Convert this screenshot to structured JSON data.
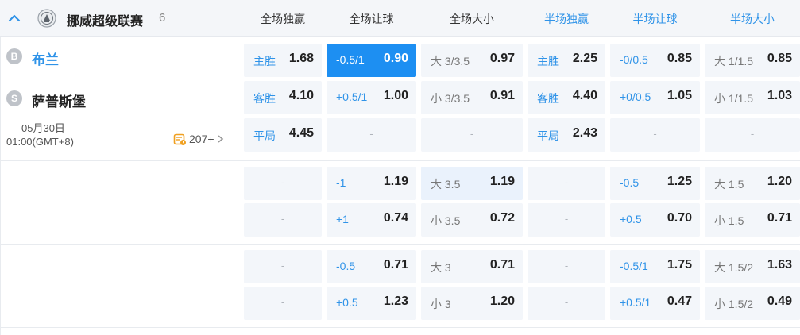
{
  "league": {
    "name": "挪威超级联赛",
    "count": "6",
    "columns": [
      "全场独赢",
      "全场让球",
      "全场大小",
      "半场独赢",
      "半场让球",
      "半场大小"
    ]
  },
  "match": {
    "home_badge": "B",
    "home": "布兰",
    "away_badge": "S",
    "away": "萨普斯堡",
    "date": "05月30日",
    "time": "01:00(GMT+8)",
    "more": "207+"
  },
  "odds": {
    "c1": [
      [
        "主胜",
        "1.68"
      ],
      [
        "客胜",
        "4.10"
      ],
      [
        "平局",
        "4.45"
      ],
      [
        "-",
        ""
      ],
      [
        "-",
        ""
      ],
      [
        "-",
        ""
      ],
      [
        "-",
        ""
      ]
    ],
    "c2": [
      [
        "-0.5/1",
        "0.90"
      ],
      [
        "+0.5/1",
        "1.00"
      ],
      [
        "-",
        ""
      ],
      [
        "-1",
        "1.19"
      ],
      [
        "+1",
        "0.74"
      ],
      [
        "-0.5",
        "0.71"
      ],
      [
        "+0.5",
        "1.23"
      ]
    ],
    "c3": [
      [
        "大 3/3.5",
        "0.97"
      ],
      [
        "小 3/3.5",
        "0.91"
      ],
      [
        "-",
        ""
      ],
      [
        "大 3.5",
        "1.19"
      ],
      [
        "小 3.5",
        "0.72"
      ],
      [
        "大 3",
        "0.71"
      ],
      [
        "小 3",
        "1.20"
      ]
    ],
    "c4": [
      [
        "主胜",
        "2.25"
      ],
      [
        "客胜",
        "4.40"
      ],
      [
        "平局",
        "2.43"
      ],
      [
        "-",
        ""
      ],
      [
        "-",
        ""
      ],
      [
        "-",
        ""
      ],
      [
        "-",
        ""
      ]
    ],
    "c5": [
      [
        "-0/0.5",
        "0.85"
      ],
      [
        "+0/0.5",
        "1.05"
      ],
      [
        "-",
        ""
      ],
      [
        "-0.5",
        "1.25"
      ],
      [
        "+0.5",
        "0.70"
      ],
      [
        "-0.5/1",
        "1.75"
      ],
      [
        "+0.5/1",
        "0.47"
      ]
    ],
    "c6": [
      [
        "大 1/1.5",
        "0.85"
      ],
      [
        "小 1/1.5",
        "1.03"
      ],
      [
        "-",
        ""
      ],
      [
        "大 1.5",
        "1.20"
      ],
      [
        "小 1.5",
        "0.71"
      ],
      [
        "大 1.5/2",
        "1.63"
      ],
      [
        "小 1.5/2",
        "0.49"
      ]
    ]
  }
}
